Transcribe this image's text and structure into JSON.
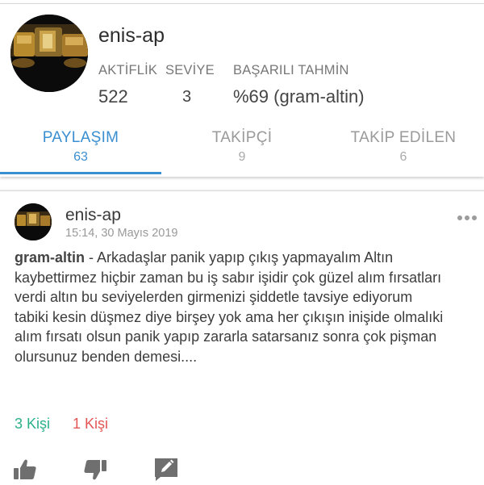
{
  "profile": {
    "username": "enis-ap",
    "avatar": "gold-bars-avatar",
    "stats": [
      {
        "label": "AKTİFLİK",
        "value": "522"
      },
      {
        "label": "SEVİYE",
        "value": "3"
      },
      {
        "label": "BAŞARILI TAHMİN",
        "value": "%69 (gram-altin)"
      }
    ]
  },
  "tabs": [
    {
      "label": "PAYLAŞIM",
      "count": "63",
      "active": true
    },
    {
      "label": "TAKİPÇİ",
      "count": "9",
      "active": false
    },
    {
      "label": "TAKİP EDİLEN",
      "count": "6",
      "active": false
    }
  ],
  "post": {
    "username": "enis-ap",
    "timestamp": "15:14, 30 Mayıs 2019",
    "topic": "gram-altin",
    "separator": " - ",
    "text": "Arkadaşlar panik yapıp çıkış yapmayalım Altın kaybettirmez hiçbir zaman bu iş sabır işidir çok güzel alım fırsatları verdi altın bu seviyelerden girmenizi şiddetle tavsiye ediyorum tabiki kesin düşmez diye birşey yok ama her çıkışın inişide olmalıki alım fırsatı olsun panik yapıp zararla satarsanız sonra çok pişman olursunuz benden demesi....",
    "agree_label": "3 Kişi",
    "disagree_label": "1 Kişi",
    "more_icon": "more-dots-icon",
    "actions": [
      {
        "icon": "thumbs-up-icon"
      },
      {
        "icon": "thumbs-down-icon"
      },
      {
        "icon": "edit-comment-icon"
      }
    ]
  },
  "colors": {
    "accent": "#3a8fd0",
    "agree": "#2bb08a",
    "disagree": "#e45555",
    "muted": "#999999"
  }
}
